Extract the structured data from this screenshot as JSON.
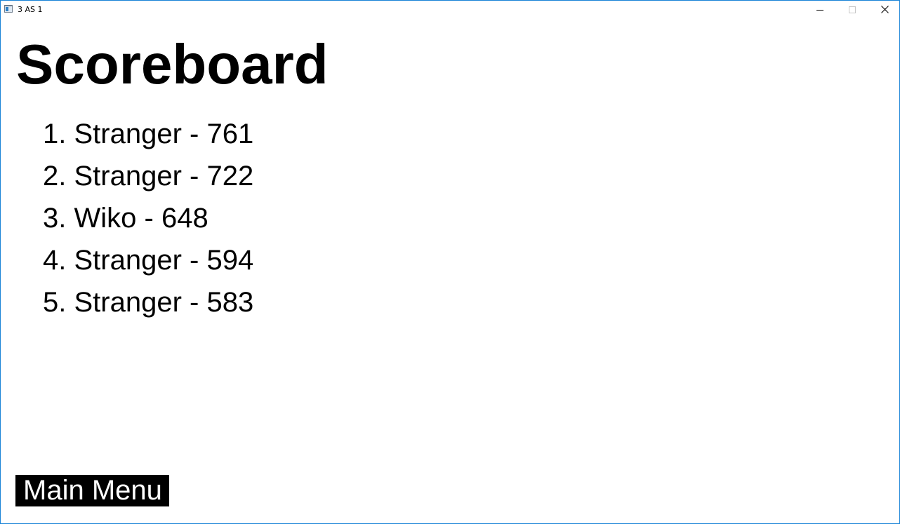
{
  "window": {
    "title": "3 AS 1"
  },
  "icons": {
    "app": "app-window-icon",
    "minimize": "minimize-icon",
    "maximize": "maximize-icon",
    "close": "close-icon"
  },
  "page": {
    "title": "Scoreboard"
  },
  "scores": [
    {
      "rank": "1.",
      "name": "Stranger",
      "separator": "-",
      "score": "761"
    },
    {
      "rank": "2.",
      "name": "Stranger",
      "separator": "-",
      "score": "722"
    },
    {
      "rank": "3.",
      "name": "Wiko",
      "separator": "-",
      "score": "648"
    },
    {
      "rank": "4.",
      "name": "Stranger",
      "separator": "-",
      "score": "594"
    },
    {
      "rank": "5.",
      "name": "Stranger",
      "separator": "-",
      "score": "583"
    }
  ],
  "buttons": {
    "main_menu": "Main Menu"
  },
  "colors": {
    "window_border": "#1883d7",
    "text": "#000000",
    "button_bg": "#000000",
    "button_text": "#ffffff"
  }
}
